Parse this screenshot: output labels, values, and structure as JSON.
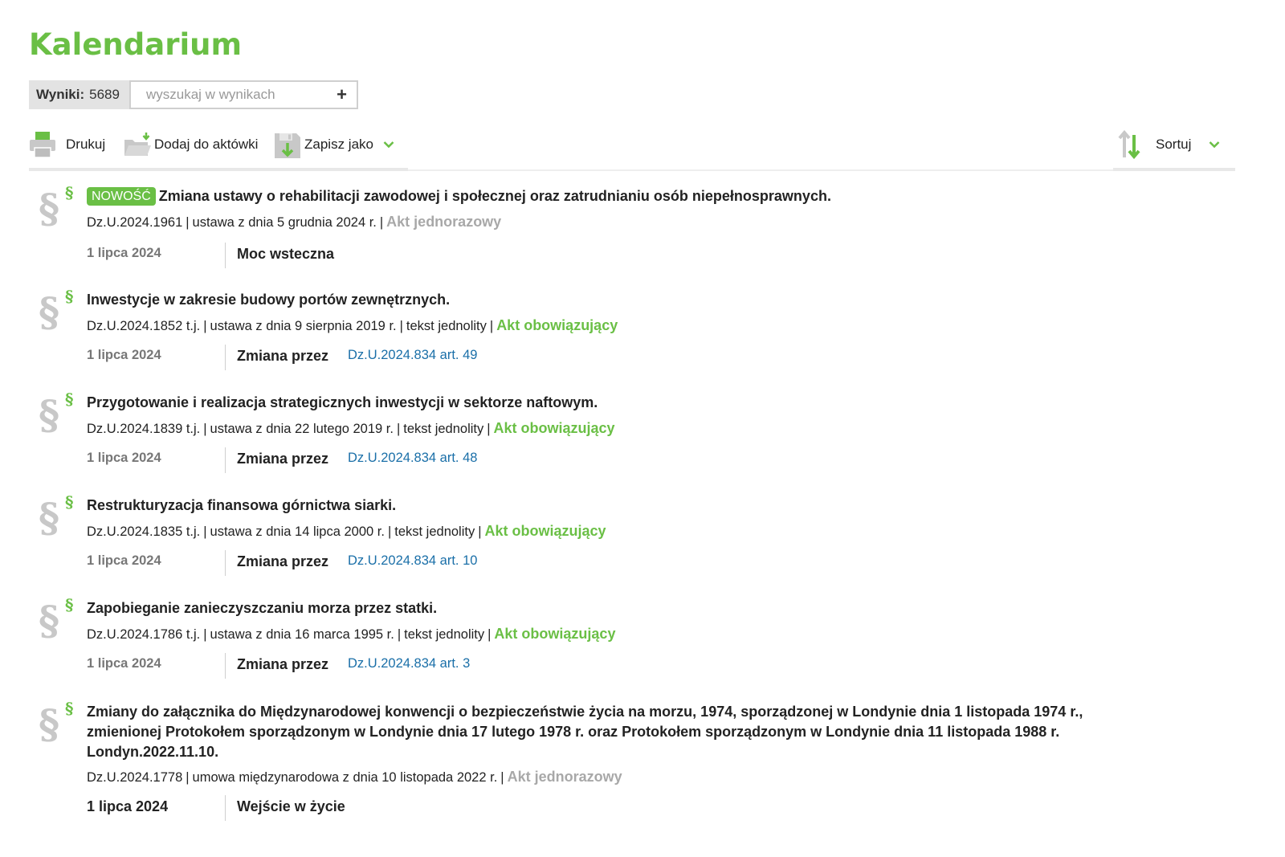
{
  "page": {
    "title": "Kalendarium"
  },
  "results": {
    "label": "Wyniki:",
    "count": "5689"
  },
  "search": {
    "placeholder": "wyszukaj w wynikach",
    "add_symbol": "+"
  },
  "toolbar": {
    "print_label": "Drukuj",
    "add_label": "Dodaj do aktówki",
    "save_label": "Zapisz jako",
    "sort_label": "Sortuj"
  },
  "colors": {
    "accent": "#6abf45",
    "link": "#1a6fa8",
    "muted": "#a8a8a8",
    "icon_gray": "#c8c8c8"
  },
  "icons": [
    "printer-icon",
    "folder-add-icon",
    "save-disk-icon",
    "chevron-down-icon",
    "sort-icon",
    "paragraph-icon"
  ],
  "separator": "|",
  "entries": [
    {
      "badge": "NOWOŚĆ",
      "title": "Zmiana ustawy o rehabilitacji zawodowej i społecznej oraz zatrudnianiu osób niepełnosprawnych.",
      "ref": "Dz.U.2024.1961",
      "desc": "ustawa z dnia 5 grudnia 2024 r.",
      "status": "Akt jednorazowy",
      "date": "1 lipca 2024",
      "change_type": "Moc wsteczna",
      "change_link": ""
    },
    {
      "title": "Inwestycje w zakresie budowy portów zewnętrznych.",
      "ref": "Dz.U.2024.1852 t.j.",
      "desc": "ustawa z dnia 9 sierpnia 2019 r.",
      "extra": "tekst jednolity",
      "status": "Akt obowiązujący",
      "date": "1 lipca 2024",
      "change_type": "Zmiana przez",
      "change_link": "Dz.U.2024.834 art. 49"
    },
    {
      "title": "Przygotowanie i realizacja strategicznych inwestycji w sektorze naftowym.",
      "ref": "Dz.U.2024.1839 t.j.",
      "desc": "ustawa z dnia 22 lutego 2019 r.",
      "extra": "tekst jednolity",
      "status": "Akt obowiązujący",
      "date": "1 lipca 2024",
      "change_type": "Zmiana przez",
      "change_link": "Dz.U.2024.834 art. 48"
    },
    {
      "title": "Restrukturyzacja finansowa górnictwa siarki.",
      "ref": "Dz.U.2024.1835 t.j.",
      "desc": "ustawa z dnia 14 lipca 2000 r.",
      "extra": "tekst jednolity",
      "status": "Akt obowiązujący",
      "date": "1 lipca 2024",
      "change_type": "Zmiana przez",
      "change_link": "Dz.U.2024.834 art. 10"
    },
    {
      "title": "Zapobieganie zanieczyszczaniu morza przez statki.",
      "ref": "Dz.U.2024.1786 t.j.",
      "desc": "ustawa z dnia 16 marca 1995 r.",
      "extra": "tekst jednolity",
      "status": "Akt obowiązujący",
      "date": "1 lipca 2024",
      "change_type": "Zmiana przez",
      "change_link": "Dz.U.2024.834 art. 3"
    },
    {
      "title": "Zmiany do załącznika do Międzynarodowej konwencji o bezpieczeństwie życia na morzu, 1974, sporządzonej w Londynie dnia 1 listopada 1974 r., zmienionej Protokołem sporządzonym w Londynie dnia 17 lutego 1978 r. oraz Protokołem sporządzonym w Londynie dnia 11 listopada 1988 r. Londyn.2022.11.10.",
      "ref": "Dz.U.2024.1778",
      "desc": "umowa międzynarodowa z dnia 10 listopada 2022 r.",
      "status": "Akt jednorazowy",
      "date": "1 lipca 2024",
      "change_type": "Wejście w życie",
      "change_link": ""
    }
  ]
}
